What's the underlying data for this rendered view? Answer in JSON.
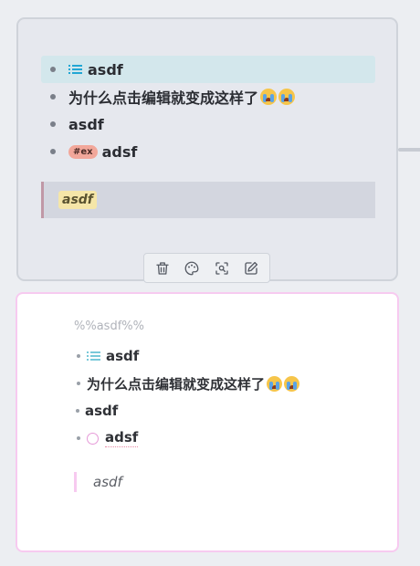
{
  "top_card": {
    "items": [
      {
        "icon": "list-icon",
        "text": "asdf"
      },
      {
        "text": "为什么点击编辑就变成这样了",
        "emojis": [
          "crying-face",
          "crying-face"
        ]
      },
      {
        "text": "asdf"
      },
      {
        "tag": "#ex",
        "text": "adsf"
      }
    ],
    "quote": "asdf"
  },
  "toolbar": {
    "buttons": [
      "delete-icon",
      "palette-icon",
      "focus-search-icon",
      "edit-icon"
    ]
  },
  "bottom_card": {
    "title": "%%asdf%%",
    "items": [
      {
        "icon": "list-icon",
        "text": "asdf"
      },
      {
        "text": "为什么点击编辑就变成这样了",
        "emojis": [
          "crying-face",
          "crying-face"
        ]
      },
      {
        "text": "asdf"
      },
      {
        "icon": "tag-ring-icon",
        "text": "adsf"
      }
    ],
    "quote": "asdf"
  },
  "colors": {
    "accent": "#22a6d4",
    "selection": "#d3e7ec",
    "tag_bg": "#f2a79a",
    "quote_border": "#c098a6",
    "bottom_border": "#f7caf0"
  }
}
